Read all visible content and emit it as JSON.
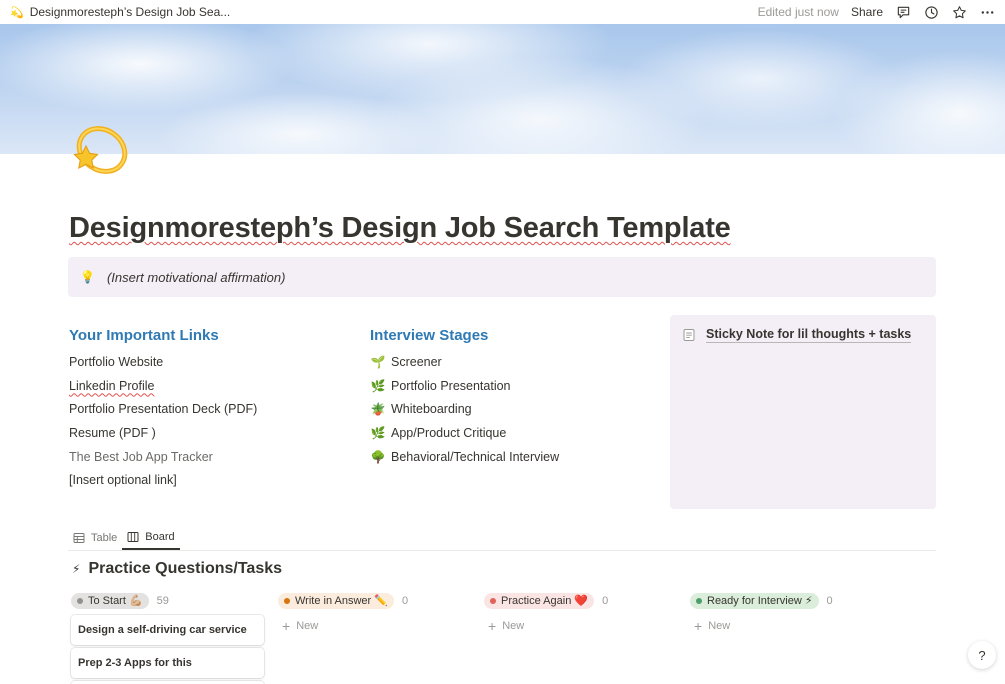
{
  "topbar": {
    "page_emoji": "💫",
    "breadcrumb": "Designmoresteph’s Design Job Sea...",
    "edited": "Edited just now",
    "share": "Share"
  },
  "page": {
    "title": "Designmoresteph’s Design Job Search Template",
    "icon": "dizzy-star-icon"
  },
  "callout": {
    "emoji": "💡",
    "text": "(Insert motivational affirmation)"
  },
  "links": {
    "heading": "Your Important Links",
    "items": [
      "Portfolio Website",
      "Linkedin Profile",
      "Portfolio Presentation Deck (PDF)",
      "Resume (PDF )",
      "The Best Job App Tracker",
      "[Insert optional link]"
    ]
  },
  "stages": {
    "heading": "Interview Stages",
    "items": [
      {
        "emoji": "🌱",
        "label": "Screener"
      },
      {
        "emoji": "🌿",
        "label": "Portfolio Presentation"
      },
      {
        "emoji": "🪴",
        "label": "Whiteboarding"
      },
      {
        "emoji": "🌿",
        "label": "App/Product Critique"
      },
      {
        "emoji": "🌳",
        "label": "Behavioral/Technical Interview"
      }
    ]
  },
  "sticky": {
    "title": "Sticky Note for lil thoughts + tasks"
  },
  "views": {
    "table": "Table",
    "board": "Board"
  },
  "database": {
    "emoji": "⚡",
    "title": "Practice Questions/Tasks"
  },
  "board": {
    "new_label": "New",
    "columns": [
      {
        "label": "To Start 💪🏼",
        "count": "59",
        "pill_bg": "#e3e2e0",
        "dot": "#91918e",
        "cards": [
          "Design a self-driving car service",
          "Prep 2-3 Apps for this"
        ]
      },
      {
        "label": "Write in Answer ✏️",
        "count": "0",
        "pill_bg": "#fbecdd",
        "dot": "#d9730d"
      },
      {
        "label": "Practice Again ❤️",
        "count": "0",
        "pill_bg": "#fbe4e4",
        "dot": "#e16259"
      },
      {
        "label": "Ready for Interview ⚡",
        "count": "0",
        "pill_bg": "#dbeddb",
        "dot": "#4d9e6a"
      }
    ]
  },
  "help": "?"
}
